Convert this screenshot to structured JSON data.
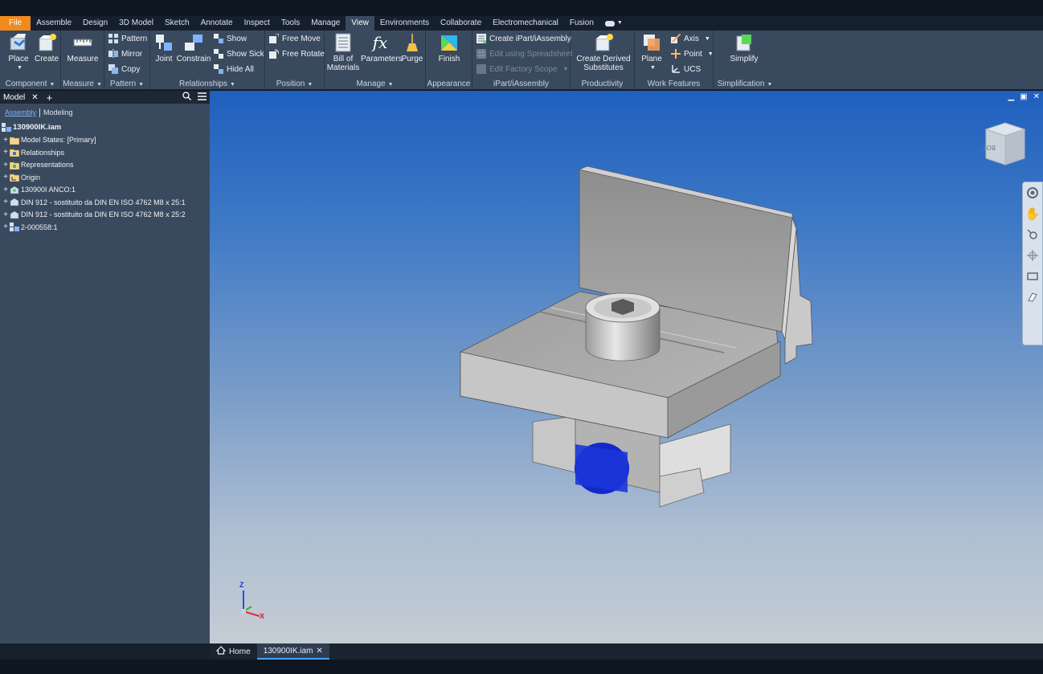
{
  "tabs": [
    "File",
    "Assemble",
    "Design",
    "3D Model",
    "Sketch",
    "Annotate",
    "Inspect",
    "Tools",
    "Manage",
    "View",
    "Environments",
    "Collaborate",
    "Electromechanical",
    "Fusion"
  ],
  "active_tab": "View",
  "ribbon": {
    "component": {
      "label": "Component",
      "place": "Place",
      "create": "Create"
    },
    "measure": {
      "label": "Measure",
      "measure": "Measure"
    },
    "pattern": {
      "label": "Pattern",
      "pattern": "Pattern",
      "mirror": "Mirror",
      "copy": "Copy"
    },
    "relationships": {
      "label": "Relationships",
      "joint": "Joint",
      "constrain": "Constrain",
      "show": "Show",
      "show_sick": "Show Sick",
      "hide_all": "Hide All"
    },
    "position": {
      "label": "Position",
      "free_move": "Free Move",
      "free_rotate": "Free Rotate"
    },
    "manage": {
      "label": "Manage",
      "bom_line1": "Bill of",
      "bom_line2": "Materials",
      "parameters": "Parameters",
      "purge": "Purge"
    },
    "appearance": {
      "label": "Appearance",
      "finish": "Finish"
    },
    "ipart": {
      "label": "iPart/iAssembly",
      "create": "Create iPart/iAssembly",
      "edit_spreadsheet": "Edit using Spreadsheet",
      "edit_factory": "Edit Factory Scope"
    },
    "productivity": {
      "label": "Productivity",
      "derived_line1": "Create Derived",
      "derived_line2": "Substitutes"
    },
    "work_features": {
      "label": "Work Features",
      "plane": "Plane",
      "axis": "Axis",
      "point": "Point",
      "ucs": "UCS"
    },
    "simplification": {
      "label": "Simplification",
      "simplify": "Simplify"
    }
  },
  "browser": {
    "title": "Model",
    "subtabs": [
      "Assembly",
      "Modeling"
    ],
    "root": "130900IK.iam",
    "items": [
      "Model States: [Primary]",
      "Relationships",
      "Representations",
      "Origin",
      "130900I ANCO:1",
      "DIN 912 - sostituito da DIN EN ISO 4762 M8 x 25:1",
      "DIN 912 - sostituito da DIN EN ISO 4762 M8 x 25:2",
      "2-000558:1"
    ]
  },
  "viewcube_label": "BOTTOM",
  "triad": {
    "z": "Z",
    "x": "X"
  },
  "doc_tabs": {
    "home": "Home",
    "active_doc": "130900IK.iam"
  },
  "colors": {
    "file_tab": "#f08a1c",
    "ribbon": "#3a4a5e",
    "accent": "#4aa3ff",
    "bolt_blue": "#1329c9"
  }
}
